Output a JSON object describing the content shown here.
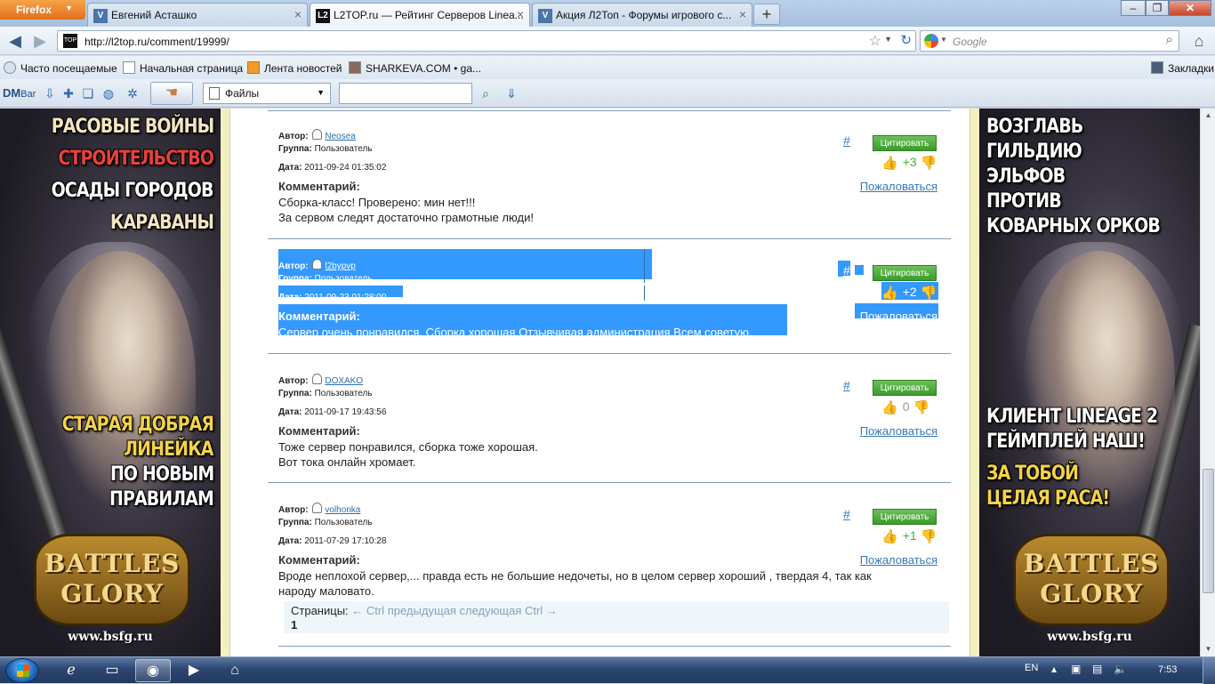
{
  "browser": {
    "menu_button": "Firefox",
    "tabs": [
      {
        "title": "Евгений Асташко",
        "favicon": "V",
        "favicon_color": "#4a76a8",
        "active": false
      },
      {
        "title": "L2TOP.ru — Рейтинг Серверов Linea...",
        "favicon": "L2",
        "favicon_color": "#111111",
        "active": true
      },
      {
        "title": "Акция Л2Топ - Форумы игрового с...",
        "favicon": "V",
        "favicon_color": "#4a76a8",
        "active": false
      }
    ],
    "url": "http://l2top.ru/comment/19999/",
    "search_placeholder": "Google",
    "bookmarks": [
      {
        "label": "Часто посещаемые"
      },
      {
        "label": "Начальная страница"
      },
      {
        "label": "Лента новостей"
      },
      {
        "label": "SHARKEVA.COM • ga..."
      }
    ],
    "bookmarks_menu": "Закладки"
  },
  "dmbar": {
    "logo": "DM",
    "logo_suffix": "Bar",
    "files_label": "Файлы"
  },
  "banners": {
    "left": {
      "lines": [
        {
          "text": "РАСОВЫЕ ВОЙНЫ",
          "color": "#f2e6c0"
        },
        {
          "text": "СТРОИТЕЛЬСТВО",
          "color": "#e8413c"
        },
        {
          "text": "ОСАДЫ ГОРОДОВ",
          "color": "#ffffff"
        },
        {
          "text": "КАРАВАНЫ",
          "color": "#f2e6c0"
        }
      ],
      "slogan": [
        {
          "text": "СТАРАЯ ДОБРАЯ",
          "color": "#f4d24a"
        },
        {
          "text": "ЛИНЕЙКА",
          "color": "#f4d24a"
        },
        {
          "text": "ПО НОВЫМ",
          "color": "#ffffff"
        },
        {
          "text": "ПРАВИЛАМ",
          "color": "#ffffff"
        }
      ],
      "logo_line1": "BATTLES",
      "logo_line2": "GLORY",
      "url": "www.bsfg.ru"
    },
    "right": {
      "lines": [
        {
          "text": "ВОЗГЛАВЬ",
          "color": "#ffffff"
        },
        {
          "text": "ГИЛЬДИЮ",
          "color": "#ffffff"
        },
        {
          "text": "ЭЛЬФОВ",
          "color": "#ffffff"
        },
        {
          "text": "ПРОТИВ",
          "color": "#ffffff"
        },
        {
          "text": "КОВАРНЫХ ОРКОВ",
          "color": "#ffffff"
        }
      ],
      "slogan": [
        {
          "text": "КЛИЕНТ LINEAGE 2",
          "color": "#ffffff"
        },
        {
          "text": "ГЕЙМПЛЕЙ НАШ!",
          "color": "#ffffff"
        },
        {
          "text": "ЗА ТОБОЙ",
          "color": "#f4d24a"
        },
        {
          "text": "ЦЕЛАЯ РАСА!",
          "color": "#f4d24a"
        }
      ],
      "logo_line1": "BATTLES",
      "logo_line2": "GLORY",
      "url": "www.bsfg.ru"
    }
  },
  "labels": {
    "author": "Автор:",
    "group": "Группа:",
    "date": "Дата:",
    "comment": "Комментарий:",
    "quote_button": "Цитировать",
    "report_link": "Пожаловаться",
    "permalink": "#"
  },
  "comments": [
    {
      "author": "Neosea",
      "group": "Пользователь",
      "date": "2011-09-24 01:35:02",
      "score": "+3",
      "score_color": "#3fb43a",
      "thumbs_style": "gray",
      "selected": false,
      "lines": [
        "Сборка-класс! Проверено: мин нет!!!",
        "За сервом следят достаточно грамотные люди!"
      ]
    },
    {
      "author": "l2bypvp",
      "group": "Пользователь",
      "date": "2011-09-23 01:28:00",
      "score": "+2",
      "score_color": "#ffffff",
      "thumbs_style": "gray",
      "selected": true,
      "lines": [
        "Сервер очень понравился. Сборка хорошая.Отзывчивая администрация.Всем советую."
      ]
    },
    {
      "author": "DOXAKO",
      "group": "Пользователь",
      "date": "2011-09-17 19:43:56",
      "score": "0",
      "score_color": "#9a9a9a",
      "thumbs_style": "color",
      "selected": false,
      "lines": [
        "Тоже сервер понравился, сборка тоже хорошая.",
        "Вот тока онлайн хромает."
      ]
    },
    {
      "author": "volhonka",
      "group": "Пользователь",
      "date": "2011-07-29 17:10:28",
      "score": "+1",
      "score_color": "#3fb43a",
      "thumbs_style": "color",
      "selected": false,
      "lines": [
        "Вроде неплохой сервер,... правда есть не большие недочеты, но в целом сервер хороший , твердая 4, так как",
        "народу маловато."
      ]
    }
  ],
  "pager": {
    "label": "Страницы:",
    "nav": "← Ctrl предыдущая следующая Ctrl →",
    "current": "1"
  },
  "taskbar": {
    "lang": "EN",
    "time": "7:53"
  }
}
